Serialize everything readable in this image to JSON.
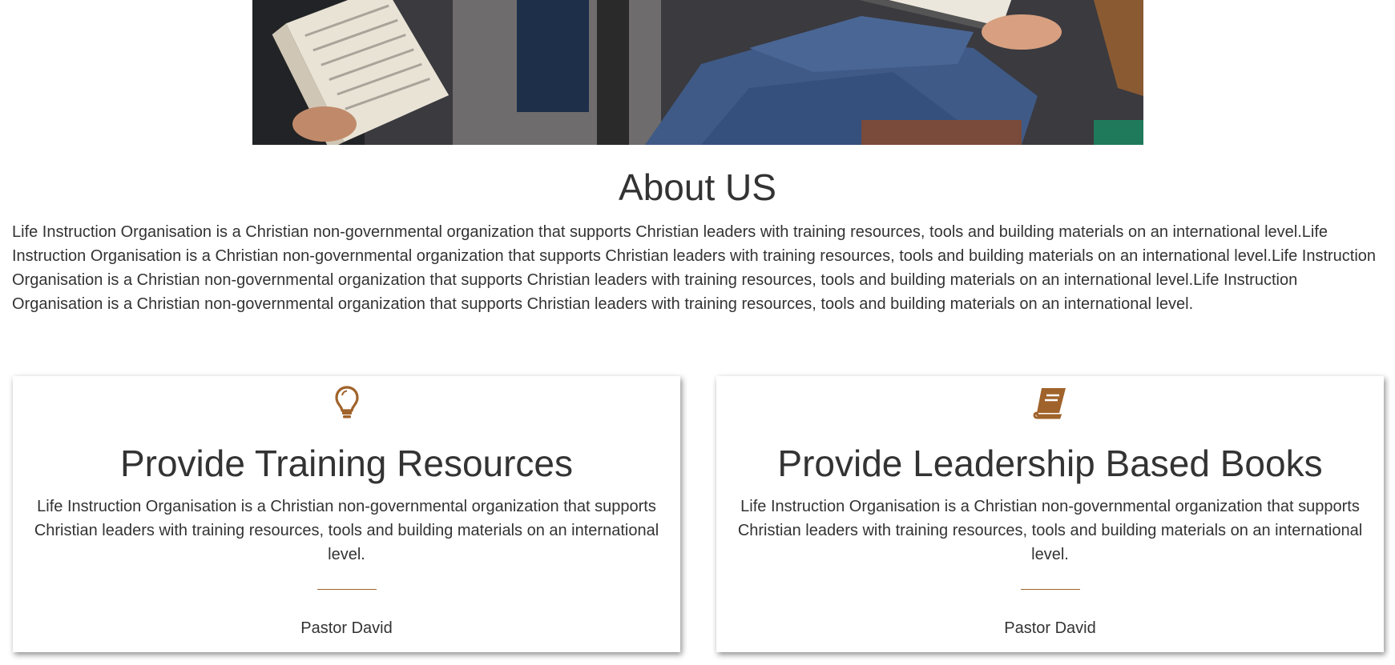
{
  "about": {
    "title": "About US",
    "text": "Life Instruction Organisation is a Christian non-governmental organization that supports Christian leaders with training resources, tools and building materials on an international level.Life Instruction Organisation is a Christian non-governmental organization that supports Christian leaders with training resources, tools and building materials on an international level.Life Instruction Organisation is a Christian non-governmental organization that supports Christian leaders with training resources, tools and building materials on an international level.Life Instruction Organisation is a Christian non-governmental organization that supports Christian leaders with training resources, tools and building materials on an international level."
  },
  "cards": [
    {
      "icon": "lightbulb-icon",
      "title": "Provide Training Resources",
      "text": "Life Instruction Organisation is a Christian non-governmental organization that supports Christian leaders with training resources, tools and building materials on an international level.",
      "author": "Pastor David"
    },
    {
      "icon": "book-icon",
      "title": "Provide Leadership Based Books",
      "text": "Life Instruction Organisation is a Christian non-governmental organization that supports Christian leaders with training resources, tools and building materials on an international level.",
      "author": "Pastor David"
    }
  ],
  "colors": {
    "accent": "#a0632b",
    "text": "#333333",
    "background": "#ffffff"
  }
}
